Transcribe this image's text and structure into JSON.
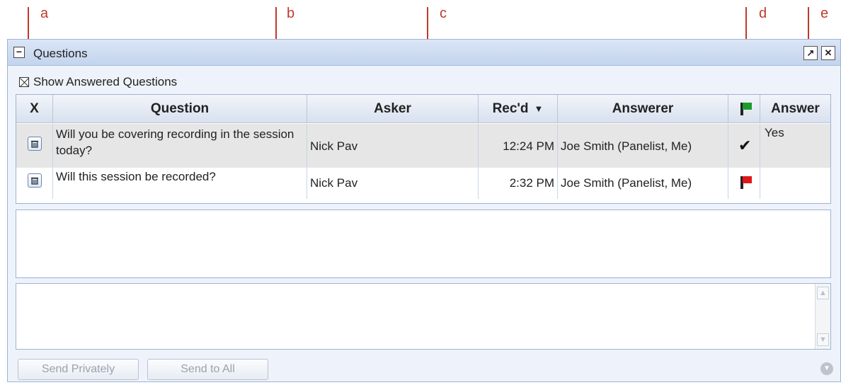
{
  "callouts": [
    "a",
    "b",
    "c",
    "d",
    "e"
  ],
  "window": {
    "title": "Questions"
  },
  "show_answered": {
    "label": "Show Answered Questions",
    "checked": true
  },
  "table": {
    "columns": [
      "X",
      "Question",
      "Asker",
      "Rec'd",
      "Answerer",
      "flag",
      "Answer"
    ],
    "sort_indicator": "▼",
    "rows": [
      {
        "question": "Will you be covering recording in the session today?",
        "asker": "Nick Pav",
        "received": "12:24 PM",
        "answerer": "Joe Smith (Panelist, Me)",
        "status": "answered",
        "answer": "Yes"
      },
      {
        "question": "Will this session be recorded?",
        "asker": "Nick Pav",
        "received": "2:32 PM",
        "answerer": "Joe Smith (Panelist, Me)",
        "status": "flagged",
        "answer": ""
      }
    ]
  },
  "buttons": {
    "send_privately": "Send Privately",
    "send_to_all": "Send to All"
  },
  "icons": {
    "collapse": "minus-box-icon",
    "popout": "popout-icon",
    "close": "close-icon",
    "delete": "trash-icon",
    "flag_header": "green-flag-icon",
    "flag_row": "red-flag-icon",
    "answered": "check-icon",
    "more": "chevron-down-circle-icon"
  },
  "colors": {
    "callout": "#c0392b",
    "flag_red": "#e0161b",
    "flag_green": "#1e9b2c",
    "titlebar": "#c3d4ee"
  }
}
